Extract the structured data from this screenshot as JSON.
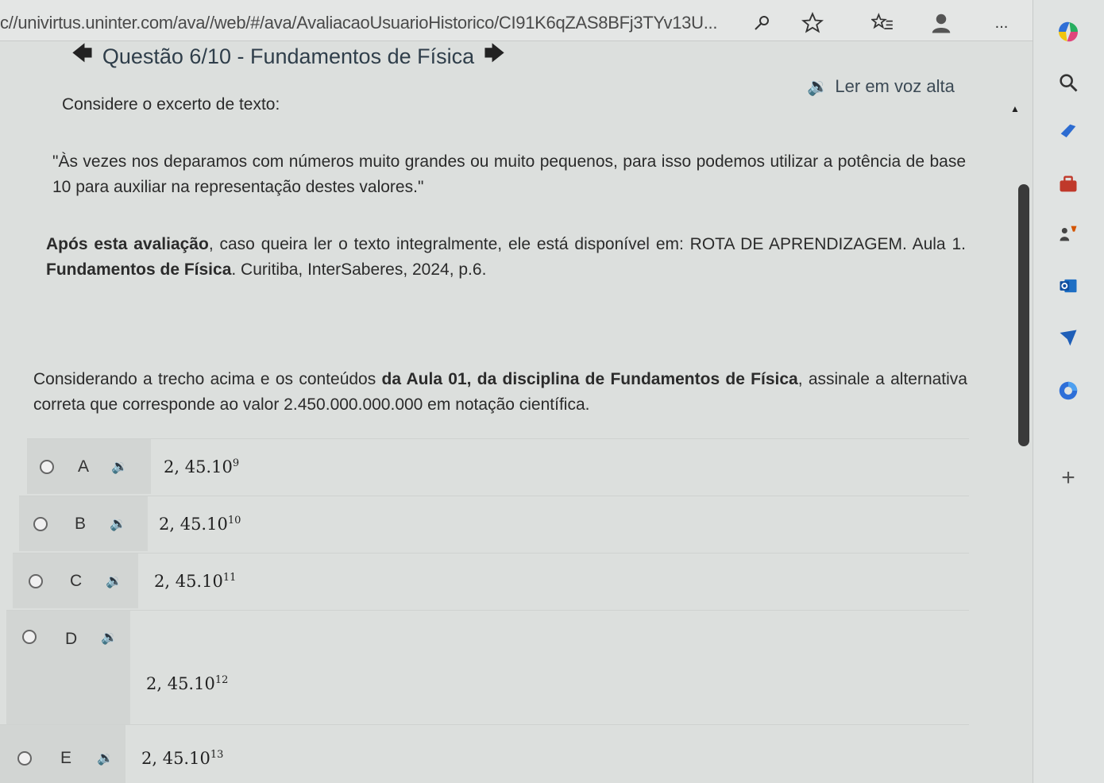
{
  "browser": {
    "url": "c//univirtus.uninter.com/ava//web/#/ava/AvaliacaoUsuarioHistorico/CI91K6qZAS8BFj3TYv13U...",
    "more_label": "..."
  },
  "header": {
    "question_title": "Questão 6/10 - Fundamentos de Física",
    "read_aloud": "Ler em voz alta"
  },
  "content": {
    "intro": "Considere o excerto de texto:",
    "quote": "\"Às vezes nos deparamos com números muito grandes ou muito pequenos, para isso podemos utilizar a potência de base 10 para auxiliar na representação destes valores.\"",
    "ref_bold1": "Após esta avaliação",
    "ref_text1": ", caso queira ler o texto integralmente, ele está disponível em: ROTA DE APRENDIZAGEM. Aula 1. ",
    "ref_bold2": "Fundamentos de Física",
    "ref_text2": ". Curitiba, InterSaberes, 2024, p.6.",
    "q_text1": "Considerando a trecho acima e os conteúdos ",
    "q_bold": "da Aula 01, da disciplina de Fundamentos de Física",
    "q_text2": ", assinale a alternativa correta que corresponde ao valor 2.450.000.000.000 em notação científica."
  },
  "options": [
    {
      "letter": "A",
      "base": "2, 45.10",
      "exp": "9"
    },
    {
      "letter": "B",
      "base": "2, 45.10",
      "exp": "10"
    },
    {
      "letter": "C",
      "base": "2, 45.10",
      "exp": "11"
    },
    {
      "letter": "D",
      "base": "2, 45.10",
      "exp": "12"
    },
    {
      "letter": "E",
      "base": "2, 45.10",
      "exp": "13"
    }
  ],
  "sidebar": {
    "add_label": "+"
  },
  "colors": {
    "accent_blue": "#2f6fd6",
    "red": "#c0392b"
  }
}
